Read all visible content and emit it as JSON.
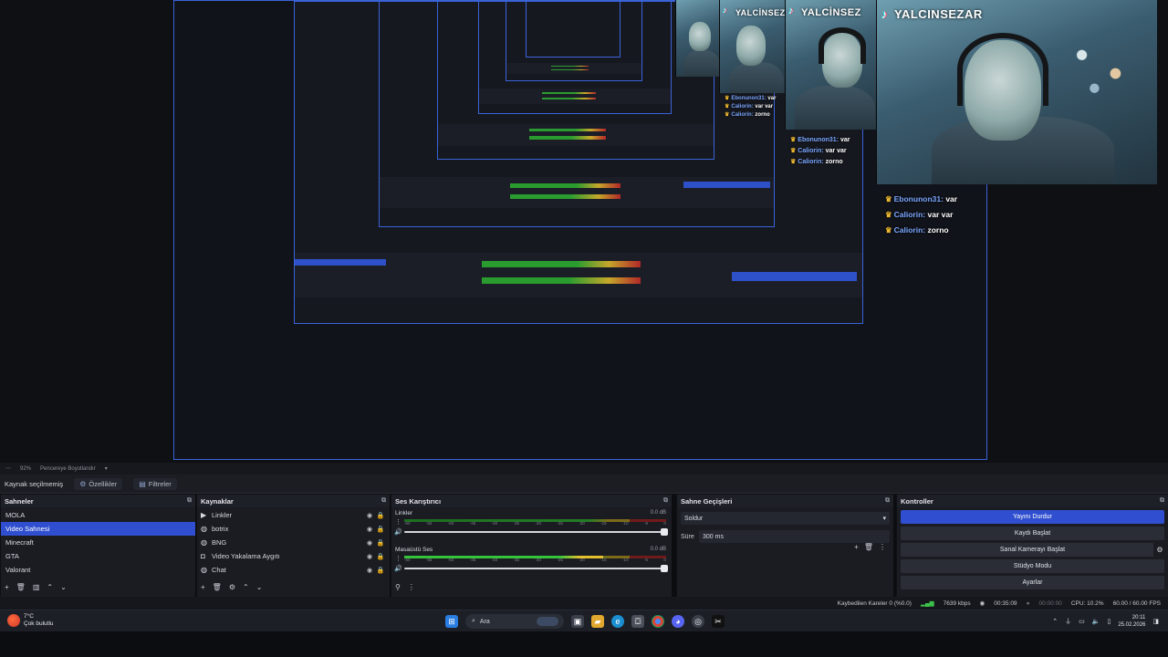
{
  "overlay": {
    "brand_small_1": "YALCİNSEZ",
    "brand_small_2": "YALCİNSEZ",
    "brand_main": "YALCINSEZAR",
    "chat_main": [
      {
        "user": "Ebonunon31:",
        "msg": "var"
      },
      {
        "user": "Caliorin:",
        "msg": "var var"
      },
      {
        "user": "Caliorin:",
        "msg": "zorno"
      }
    ],
    "chat_mid": [
      {
        "user": "Ebonunon31:",
        "msg": "var"
      },
      {
        "user": "Caliorin:",
        "msg": "var var"
      },
      {
        "user": "Caliorin:",
        "msg": "zorno"
      }
    ],
    "chat_small": [
      {
        "user": "Ebonunon31:",
        "msg": "var"
      },
      {
        "user": "Caliorin:",
        "msg": "var var"
      },
      {
        "user": "Caliorin:",
        "msg": "zorno"
      }
    ]
  },
  "zoombar": {
    "zoom": "92%",
    "mode": "Pencereye Boyutlandır"
  },
  "source_bar": {
    "status": "Kaynak seçilmemiş",
    "properties": "Özellikler",
    "filters": "Filtreler"
  },
  "scenes": {
    "title": "Sahneler",
    "items": [
      "MOLA",
      "Video Sahnesi",
      "Minecraft",
      "GTA",
      "Valorant"
    ],
    "selected_index": 1
  },
  "sources": {
    "title": "Kaynaklar",
    "items": [
      {
        "label": "Linkler",
        "icon": "play-icon"
      },
      {
        "label": "botrix",
        "icon": "browser-icon"
      },
      {
        "label": "BNG",
        "icon": "browser-icon"
      },
      {
        "label": "Video Yakalama Aygıtı",
        "icon": "camera-icon"
      },
      {
        "label": "Chat",
        "icon": "browser-icon"
      }
    ]
  },
  "mixer": {
    "title": "Ses Karıştırıcı",
    "channels": [
      {
        "name": "Linkler",
        "db": "0.0 dB",
        "level": 0
      },
      {
        "name": "Masaüstü Ses",
        "db": "0.0 dB",
        "level": 0.76
      }
    ],
    "ticks": [
      "-60",
      "-55",
      "-50",
      "-45",
      "-40",
      "-35",
      "-30",
      "-25",
      "-20",
      "-15",
      "-10",
      "-5",
      "0"
    ]
  },
  "transitions": {
    "title": "Sahne Geçişleri",
    "type": "Soldur",
    "duration_label": "Süre",
    "duration": "300 ms"
  },
  "controls": {
    "title": "Kontroller",
    "stop_stream": "Yayını Durdur",
    "start_record": "Kaydı Başlat",
    "virtual_cam": "Sanal Kamerayı Başlat",
    "studio_mode": "Stüdyo Modu",
    "settings": "Ayarlar"
  },
  "status": {
    "dropped": "Kaybedilen Kareler 0 (%0.0)",
    "bitrate": "7639 kbps",
    "stream_time": "00:35:09",
    "rec_time": "00:00:00",
    "cpu": "CPU: 10.2%",
    "fps": "60.00 / 60.00 FPS"
  },
  "taskbar": {
    "temp": "7°C",
    "weather": "Çok bulutlu",
    "search": "Ara",
    "time": "20:11",
    "date": "25.02.2026"
  },
  "colors": {
    "accent": "#2f4fd0",
    "selection_border": "#3a63d8",
    "meter_green": "#35c33b",
    "meter_yellow": "#e2c02e",
    "meter_red": "#b22828"
  }
}
